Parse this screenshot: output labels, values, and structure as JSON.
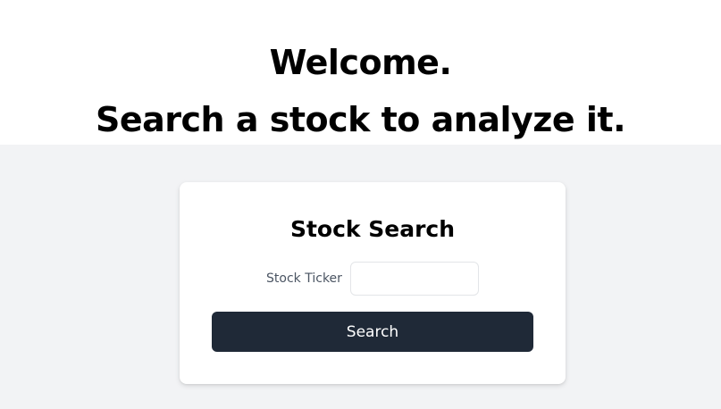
{
  "hero": {
    "line1": "Welcome.",
    "line2": "Search a stock to analyze it."
  },
  "card": {
    "title": "Stock Search",
    "ticker_label": "Stock Ticker",
    "ticker_value": "",
    "ticker_placeholder": "",
    "search_label": "Search"
  },
  "colors": {
    "page_background": "#f2f3f5",
    "button_background": "#1f2937",
    "button_text": "#ffffff",
    "label_text": "#4b5563"
  }
}
